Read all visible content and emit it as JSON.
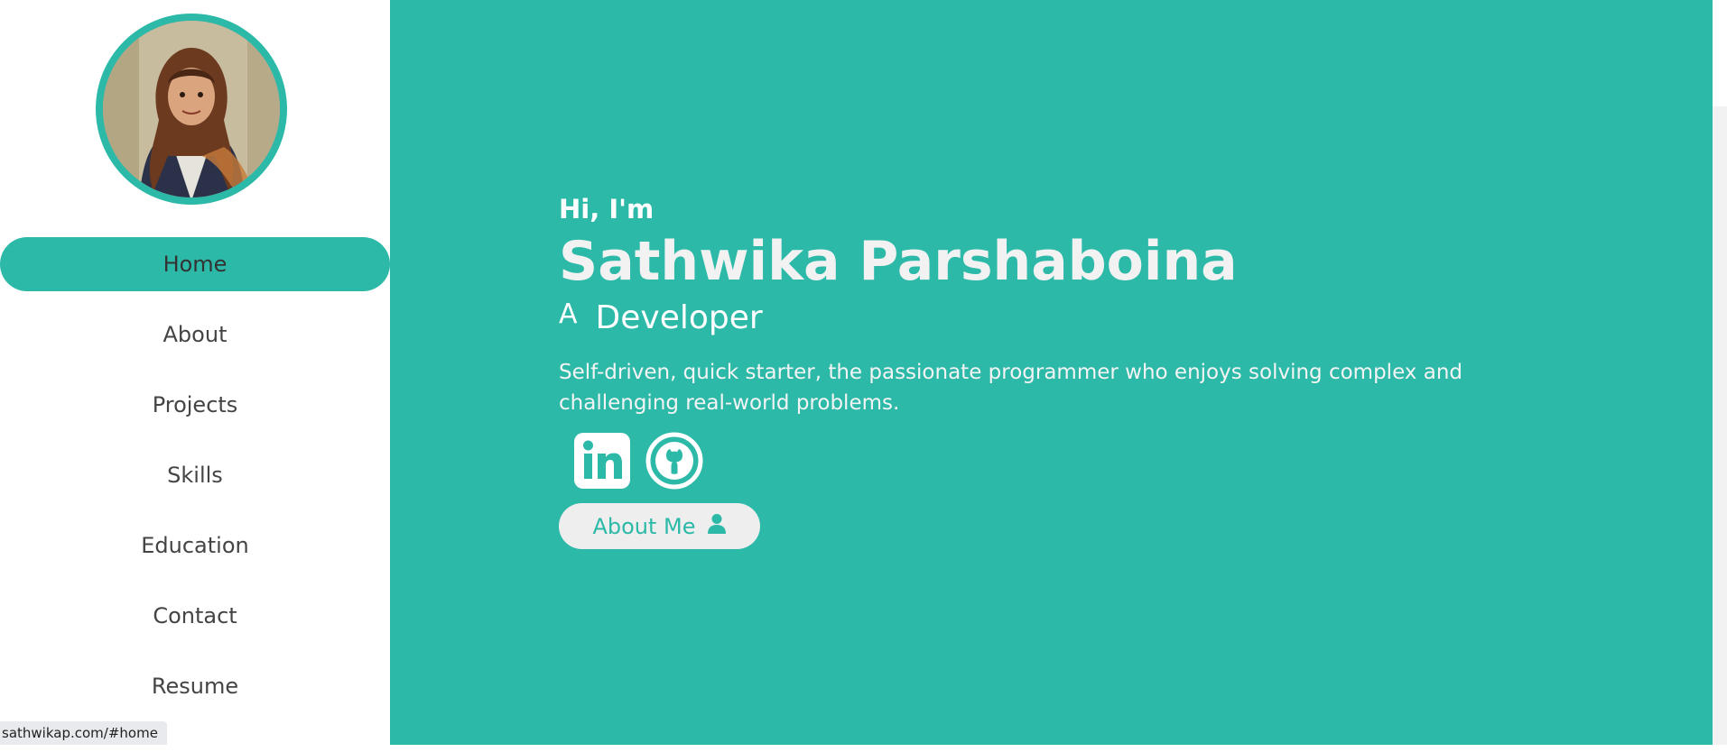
{
  "sidebar": {
    "nav": [
      {
        "label": "Home",
        "active": true
      },
      {
        "label": "About",
        "active": false
      },
      {
        "label": "Projects",
        "active": false
      },
      {
        "label": "Skills",
        "active": false
      },
      {
        "label": "Education",
        "active": false
      },
      {
        "label": "Contact",
        "active": false
      },
      {
        "label": "Resume",
        "active": false
      }
    ]
  },
  "hero": {
    "greeting": "Hi, I'm",
    "name": "Sathwika Parshaboina",
    "role_prefix": "A",
    "role": "Developer",
    "tagline": "Self-driven, quick starter, the passionate programmer who enjoys solving complex and challenging real-world problems.",
    "socials": [
      {
        "icon": "linkedin-icon"
      },
      {
        "icon": "github-icon"
      }
    ],
    "cta_label": "About Me",
    "cta_icon": "user-icon"
  },
  "status_bar": {
    "url": "sathwikap.com/#home"
  },
  "colors": {
    "accent": "#2cb9a8",
    "text_dark": "#444444",
    "button_bg": "#eeeeee"
  }
}
